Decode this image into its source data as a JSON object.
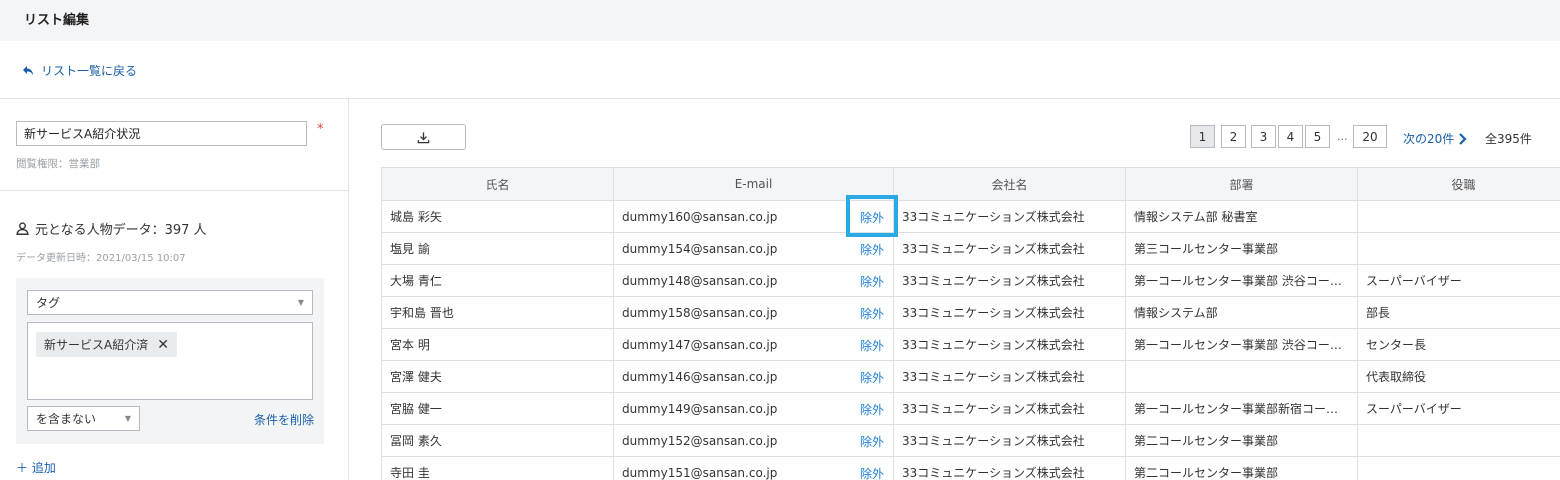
{
  "header": {
    "title": "リスト編集"
  },
  "back_link": "リスト一覧に戻る",
  "sidebar": {
    "list_name": "新サービスA紹介状況",
    "required_mark": "*",
    "permission": "閲覧権限：営業部",
    "source_label": "元となる人物データ：397 人",
    "updated": "データ更新日時：2021/03/15 10:07",
    "condition": {
      "field": "タグ",
      "tag": "新サービスA紹介済",
      "operator": "を含まない",
      "delete_label": "条件を削除"
    },
    "add_label": "＋ 追加"
  },
  "toolbar": {
    "pages": [
      "1",
      "2",
      "3",
      "4",
      "5"
    ],
    "ellipsis": "...",
    "last_page": "20",
    "current_page": "1",
    "next_label": "次の20件",
    "total": "全395件"
  },
  "table": {
    "columns": [
      "氏名",
      "E-mail",
      "会社名",
      "部署",
      "役職"
    ],
    "exclude_label": "除外",
    "rows": [
      {
        "name": "城島 彩矢",
        "email": "dummy160@sansan.co.jp",
        "company": "33コミュニケーションズ株式会社",
        "dept": "情報システム部 秘書室",
        "title": ""
      },
      {
        "name": "塩見 諭",
        "email": "dummy154@sansan.co.jp",
        "company": "33コミュニケーションズ株式会社",
        "dept": "第三コールセンター事業部",
        "title": ""
      },
      {
        "name": "大場 青仁",
        "email": "dummy148@sansan.co.jp",
        "company": "33コミュニケーションズ株式会社",
        "dept": "第一コールセンター事業部 渋谷コー…",
        "title": "スーパーバイザー"
      },
      {
        "name": "宇和島 晋也",
        "email": "dummy158@sansan.co.jp",
        "company": "33コミュニケーションズ株式会社",
        "dept": "情報システム部",
        "title": "部長"
      },
      {
        "name": "宮本 明",
        "email": "dummy147@sansan.co.jp",
        "company": "33コミュニケーションズ株式会社",
        "dept": "第一コールセンター事業部 渋谷コー…",
        "title": "センター長"
      },
      {
        "name": "宮澤 健夫",
        "email": "dummy146@sansan.co.jp",
        "company": "33コミュニケーションズ株式会社",
        "dept": "",
        "title": "代表取締役"
      },
      {
        "name": "宮脇 健一",
        "email": "dummy149@sansan.co.jp",
        "company": "33コミュニケーションズ株式会社",
        "dept": "第一コールセンター事業部新宿コール…",
        "title": "スーパーバイザー"
      },
      {
        "name": "冨岡 素久",
        "email": "dummy152@sansan.co.jp",
        "company": "33コミュニケーションズ株式会社",
        "dept": "第二コールセンター事業部",
        "title": ""
      },
      {
        "name": "寺田 圭",
        "email": "dummy151@sansan.co.jp",
        "company": "33コミュニケーションズ株式会社",
        "dept": "第二コールセンター事業部",
        "title": ""
      }
    ]
  },
  "colors": {
    "link": "#1a5fa8",
    "exclude_link": "#1a7fd6",
    "highlight": "#29a9e6",
    "required": "#e0473f",
    "header_bg": "#f4f5f7"
  },
  "icons": {
    "back": "back-arrow-icon",
    "person": "person-icon",
    "download": "download-icon",
    "next": "chevron-right-icon",
    "remove_tag": "close-icon",
    "dropdown": "caret-down-icon"
  }
}
